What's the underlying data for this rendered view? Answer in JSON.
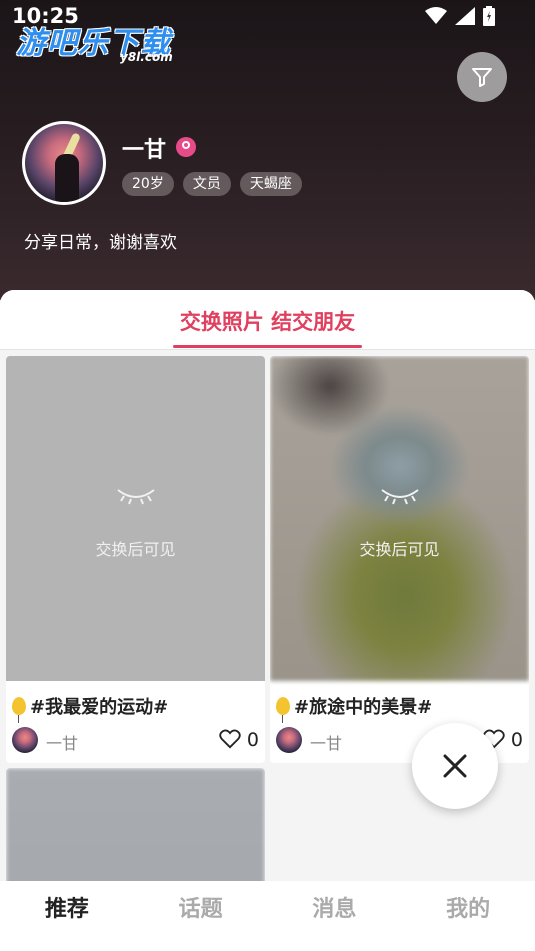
{
  "status_bar": {
    "time": "10:25"
  },
  "watermark": {
    "brand": "游吧乐下载",
    "site": "y8l.com"
  },
  "profile": {
    "name": "一甘",
    "tags": [
      "20岁",
      "文员",
      "天蝎座"
    ],
    "bio": "分享日常，谢谢喜欢"
  },
  "tab": {
    "active_label": "交换照片 结交朋友"
  },
  "cards": [
    {
      "lock_text": "交换后可见",
      "title": "#我最爱的运动#",
      "author": "一甘",
      "likes": "0"
    },
    {
      "lock_text": "交换后可见",
      "title": "#旅途中的美景#",
      "author": "一甘",
      "likes": "0"
    }
  ],
  "bottom_nav": {
    "items": [
      "推荐",
      "话题",
      "消息",
      "我的"
    ],
    "active_index": 0
  },
  "colors": {
    "accent": "#e0405f",
    "gender": "#e94b8a"
  },
  "icons": [
    "filter-icon",
    "eye-closed-icon",
    "balloon-icon",
    "heart-icon",
    "close-icon",
    "wifi-icon",
    "signal-icon",
    "battery-icon"
  ]
}
